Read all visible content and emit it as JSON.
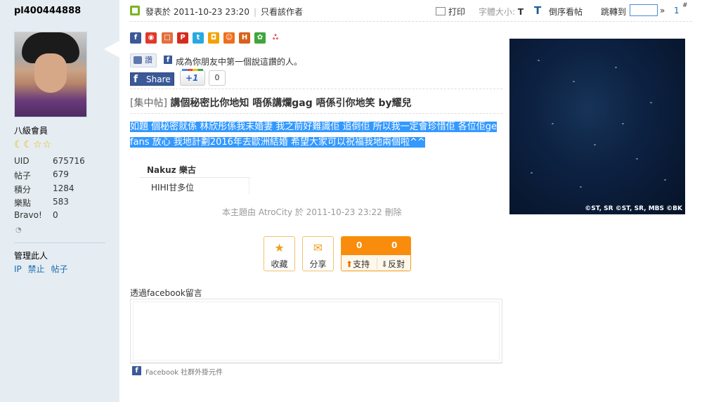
{
  "sidebar": {
    "username": "pl400444888",
    "rank": "八級會員",
    "stars": "☾☾☆☆",
    "stats": [
      {
        "key": "UID",
        "value": "675716"
      },
      {
        "key": "帖子",
        "value": "679"
      },
      {
        "key": "積分",
        "value": "1284"
      },
      {
        "key": "樂點",
        "value": "583"
      },
      {
        "key": "Bravo!",
        "value": "0"
      }
    ],
    "manage_label": "管理此人",
    "admin_links": [
      "IP",
      "禁止",
      "帖子"
    ]
  },
  "topbar": {
    "posted": "發表於 2011-10-23 23:20",
    "separator": "|",
    "only_author": "只看該作者",
    "print": "打印",
    "font_size": "字體大小:",
    "font_size_t": "T",
    "reverse_icon": "T",
    "reverse": "倒序看帖",
    "jump": "跳轉到",
    "jump_arrow": "»",
    "page": "1",
    "page_sup": "#"
  },
  "like": {
    "button": "讚",
    "text": "成為你朋友中第一個說這讚的人。"
  },
  "share": {
    "share_label": "Share",
    "plus_label": "+1",
    "plus_count": "0"
  },
  "post": {
    "tag": "[集中帖]",
    "title": "講個秘密比你地知 唔係講爛gag 唔係引你地笑 by耀兒",
    "body_line1": "如題 個秘密就係 林欣彤係我未婚妻 我之前好難識佢 追倒佢 所以我一定會珍惜佢 各位佢ge",
    "body_line2": "fans 放心 我地計劃2016年去歐洲結婚 希望大家可以祝福我地兩個啦^^",
    "signature_name": "Nakuz 樂古",
    "signature_text": "HIHI甘多位",
    "edited": "本主題由 AtroCity 於 2011-10-23 23:22 刪除"
  },
  "image": {
    "copyright": "©ST, SR ©ST, SR, MBS ©BK"
  },
  "actions": {
    "favorite": "收藏",
    "share": "分享",
    "support_count": "0",
    "oppose_count": "0",
    "support": "支持",
    "oppose": "反對"
  },
  "facebook": {
    "heading": "透過facebook留言",
    "footer": "Facebook 社群外掛元件"
  },
  "colors": {
    "sidebar_bg": "#e5edf2",
    "link": "#1a6bb0",
    "selection": "#3399ff",
    "vote_orange": "#f98c0c"
  }
}
